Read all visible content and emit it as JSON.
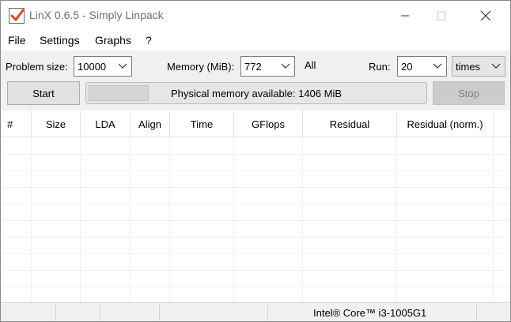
{
  "window": {
    "title": "LinX 0.6.5 - Simply Linpack"
  },
  "menu": {
    "items": [
      "File",
      "Settings",
      "Graphs",
      "?"
    ]
  },
  "controls": {
    "problem_size_label": "Problem size:",
    "problem_size_value": "10000",
    "memory_label": "Memory (MiB):",
    "memory_value": "772",
    "all_label": "All",
    "run_label": "Run:",
    "run_value": "20",
    "run_unit_value": "times",
    "start_label": "Start",
    "stop_label": "Stop",
    "memory_status": "Physical memory available: 1406 MiB",
    "progress_fraction": 0.18
  },
  "table": {
    "columns": [
      "#",
      "Size",
      "LDA",
      "Align",
      "Time",
      "GFlops",
      "Residual",
      "Residual (norm.)"
    ],
    "rows": []
  },
  "status": {
    "cpu": "Intel® Core™ i3-1005G1"
  },
  "icons": {
    "app": "checkmark-icon",
    "minimize": "minimize-icon",
    "maximize": "maximize-icon",
    "close": "close-icon",
    "dropdown": "chevron-down-icon"
  }
}
